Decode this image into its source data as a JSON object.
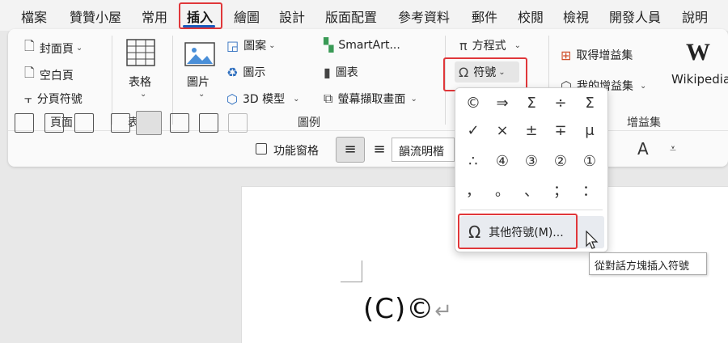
{
  "menubar": {
    "items": [
      "檔案",
      "贊贊小屋",
      "常用",
      "插入",
      "繪圖",
      "設計",
      "版面配置",
      "參考資料",
      "郵件",
      "校閱",
      "檢視",
      "開發人員",
      "說明"
    ],
    "active": "插入"
  },
  "ribbon": {
    "pages": {
      "cover_page": "封面頁",
      "blank_page": "空白頁",
      "page_break": "分頁符號",
      "group_label": "頁面"
    },
    "table": {
      "label": "表格",
      "group_label": "表格"
    },
    "illustrations": {
      "picture": "圖片",
      "shapes": "圖案",
      "icons": "圖示",
      "model_3d": "3D 模型",
      "smartart": "SmartArt...",
      "chart": "圖表",
      "screenshot": "螢幕擷取畫面",
      "group_label": "圖例"
    },
    "symbols": {
      "equation": "方程式",
      "symbol": "符號"
    },
    "addins": {
      "get_addins": "取得增益集",
      "my_addins": "我的增益集",
      "wikipedia": "Wikipedia",
      "group_label": "增益集"
    }
  },
  "quickbar": {
    "function_pane": "功能窗格",
    "font_name": "韻流明楷"
  },
  "symbol_dropdown": {
    "symbols": [
      "©",
      "⇒",
      "Σ",
      "÷",
      "Σ",
      "✓",
      "×",
      "±",
      "∓",
      "μ",
      "∴",
      "④",
      "③",
      "②",
      "①",
      "，",
      "。",
      "、",
      "；",
      "："
    ],
    "more_symbols": "其他符號(M)..."
  },
  "tooltip": "從對話方塊插入符號",
  "document": {
    "text": "(C)©",
    "return_mark": "↵"
  }
}
